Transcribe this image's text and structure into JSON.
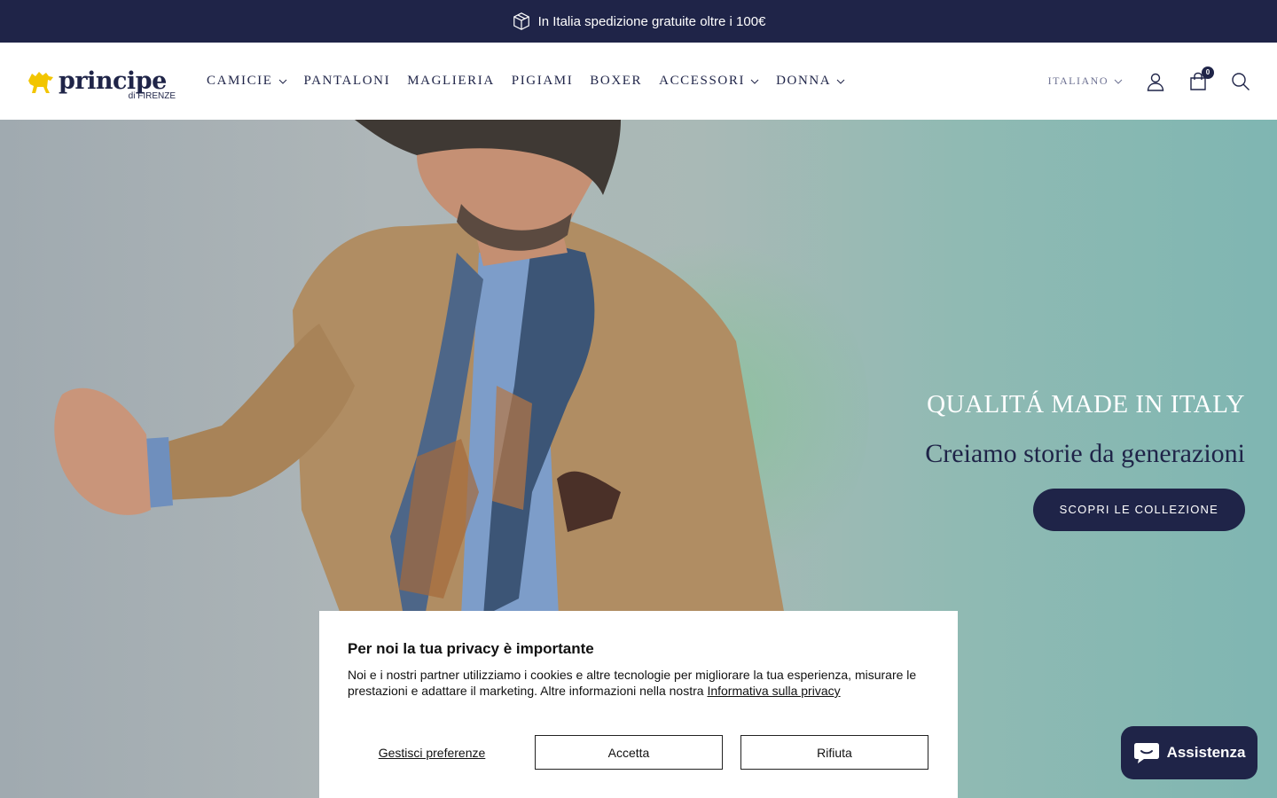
{
  "announcement": {
    "text": "In Italia spedizione gratuite oltre i 100€",
    "icon": "box-icon"
  },
  "logo": {
    "name": "principe",
    "sub": "di FIRENZE"
  },
  "nav": [
    {
      "label": "CAMICIE",
      "dropdown": true
    },
    {
      "label": "PANTALONI",
      "dropdown": false
    },
    {
      "label": "MAGLIERIA",
      "dropdown": false
    },
    {
      "label": "PIGIAMI",
      "dropdown": false
    },
    {
      "label": "BOXER",
      "dropdown": false
    },
    {
      "label": "ACCESSORI",
      "dropdown": true
    },
    {
      "label": "DONNA",
      "dropdown": true
    }
  ],
  "header": {
    "language": "ITALIANO",
    "cart_count": "0"
  },
  "hero": {
    "kicker": "QUALITÁ MADE IN ITALY",
    "title": "Creiamo storie da generazioni",
    "cta": "SCOPRI LE COLLEZIONE"
  },
  "cookie": {
    "title": "Per noi la tua privacy è importante",
    "text": "Noi e i nostri partner utilizziamo i cookies e altre tecnologie per migliorare la tua esperienza, misurare le prestazioni e adattare il marketing. Altre informazioni nella nostra ",
    "link": "Informativa sulla privacy",
    "preferences": "Gestisci preferenze",
    "accept": "Accetta",
    "reject": "Rifiuta"
  },
  "chat": {
    "label": "Assistenza"
  },
  "colors": {
    "navy": "#1f2448",
    "logo_yellow": "#f2c500"
  }
}
